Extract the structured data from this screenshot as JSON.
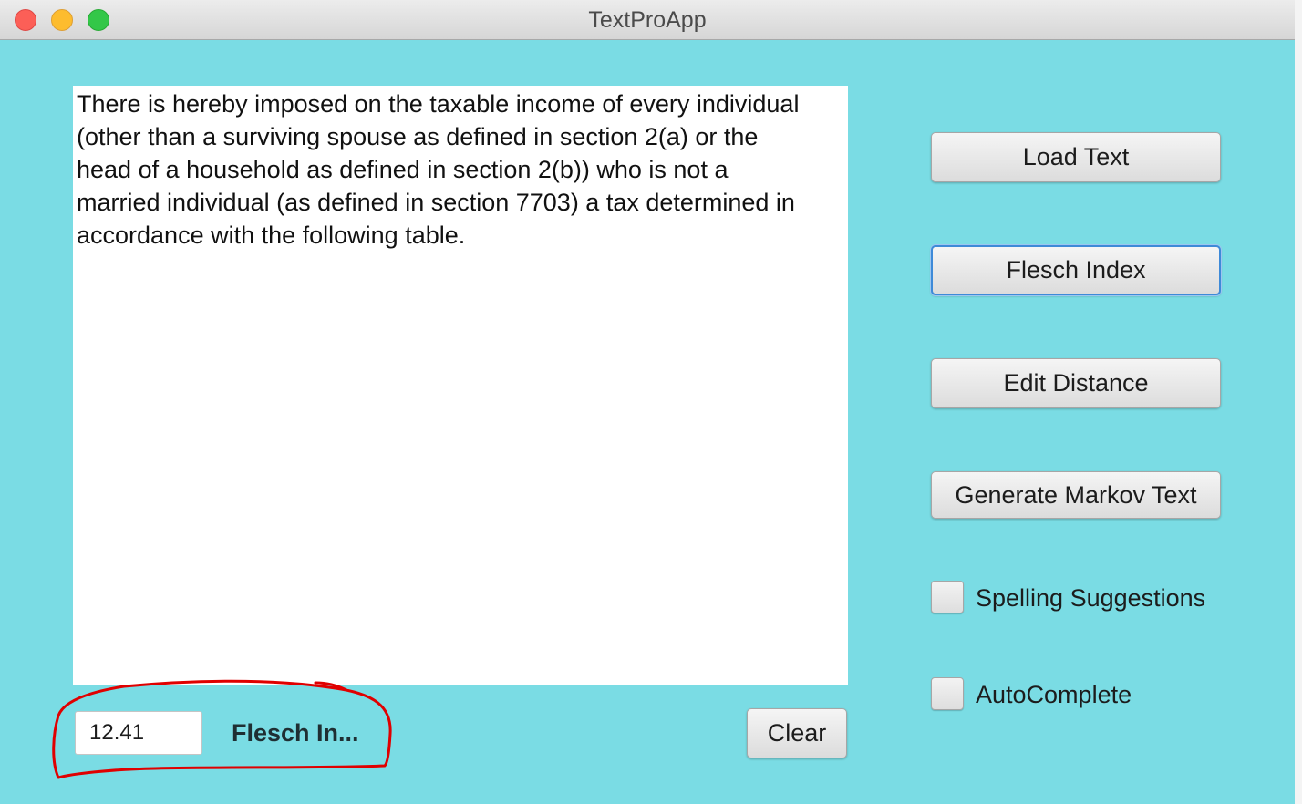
{
  "window": {
    "title": "TextProApp"
  },
  "editor": {
    "text": "There is hereby imposed on the taxable income of every individual\n(other than a surviving spouse as defined in section 2(a) or the\nhead of a household as defined in section 2(b)) who is not a\nmarried individual (as defined in section 7703) a tax determined in\naccordance with the following table."
  },
  "buttons": {
    "load_text": "Load Text",
    "flesch_index": "Flesch Index",
    "edit_distance": "Edit Distance",
    "generate_markov": "Generate Markov Text",
    "clear": "Clear"
  },
  "checkboxes": {
    "spelling_suggestions": {
      "label": "Spelling Suggestions",
      "checked": false
    },
    "autocomplete": {
      "label": "AutoComplete",
      "checked": false
    }
  },
  "result": {
    "value": "12.41",
    "label": "Flesch In..."
  },
  "colors": {
    "background": "#7adce4",
    "annotation": "#e00000",
    "focus_ring": "#3e8ad8"
  }
}
